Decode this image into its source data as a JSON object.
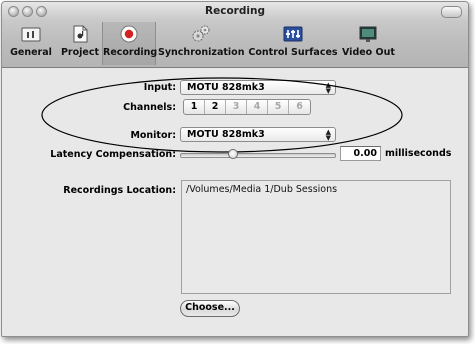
{
  "window": {
    "title": "Recording"
  },
  "toolbar": {
    "items": [
      {
        "label": "General",
        "icon": "general-icon"
      },
      {
        "label": "Project",
        "icon": "project-icon"
      },
      {
        "label": "Recording",
        "icon": "record-icon",
        "selected": true
      },
      {
        "label": "Synchronization",
        "icon": "sync-gears-icon"
      },
      {
        "label": "Control Surfaces",
        "icon": "control-surfaces-icon"
      },
      {
        "label": "Video Out",
        "icon": "video-out-icon"
      }
    ]
  },
  "settings": {
    "input_label": "Input:",
    "input_value": "MOTU 828mk3",
    "channels_label": "Channels:",
    "channels": [
      {
        "label": "1",
        "enabled": true
      },
      {
        "label": "2",
        "enabled": true
      },
      {
        "label": "3",
        "enabled": false
      },
      {
        "label": "4",
        "enabled": false
      },
      {
        "label": "5",
        "enabled": false
      },
      {
        "label": "6",
        "enabled": false
      }
    ],
    "monitor_label": "Monitor:",
    "monitor_value": "MOTU 828mk3",
    "latency_label": "Latency Compensation:",
    "latency_value": "0.00",
    "latency_unit": "milliseconds",
    "latency_slider_fraction": 0.35,
    "recordings_location_label": "Recordings Location:",
    "recordings_location_value": "/Volumes/Media 1/Dub Sessions",
    "choose_button": "Choose..."
  },
  "colors": {
    "record_red": "#d42020",
    "selected_tab": "#aaaaaa",
    "highlight_ellipse": "#000000"
  }
}
